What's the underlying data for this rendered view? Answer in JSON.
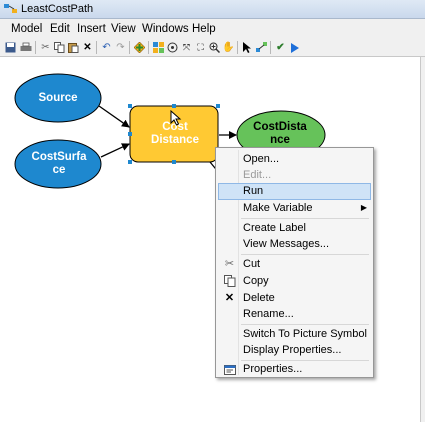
{
  "window": {
    "title": "LeastCostPath"
  },
  "menu": [
    "Model",
    "Edit",
    "Insert",
    "View",
    "Windows",
    "Help"
  ],
  "nodes": {
    "source": "Source",
    "cost_surface": "CostSurfa ce",
    "cost_distance_tool": "Cost Distance",
    "cost_distance_output": "CostDista nce"
  },
  "context_menu": {
    "open": "Open...",
    "edit": "Edit...",
    "run": "Run",
    "make_variable": "Make Variable",
    "create_label": "Create Label",
    "view_messages": "View Messages...",
    "cut": "Cut",
    "copy": "Copy",
    "delete": "Delete",
    "rename": "Rename...",
    "switch_picture": "Switch To Picture Symbol",
    "display_properties": "Display Properties...",
    "properties": "Properties..."
  },
  "colors": {
    "data_node": "#1e88cf",
    "tool_node": "#ffc933",
    "output_node": "#66c25a",
    "highlight": "#cfe3f7"
  }
}
